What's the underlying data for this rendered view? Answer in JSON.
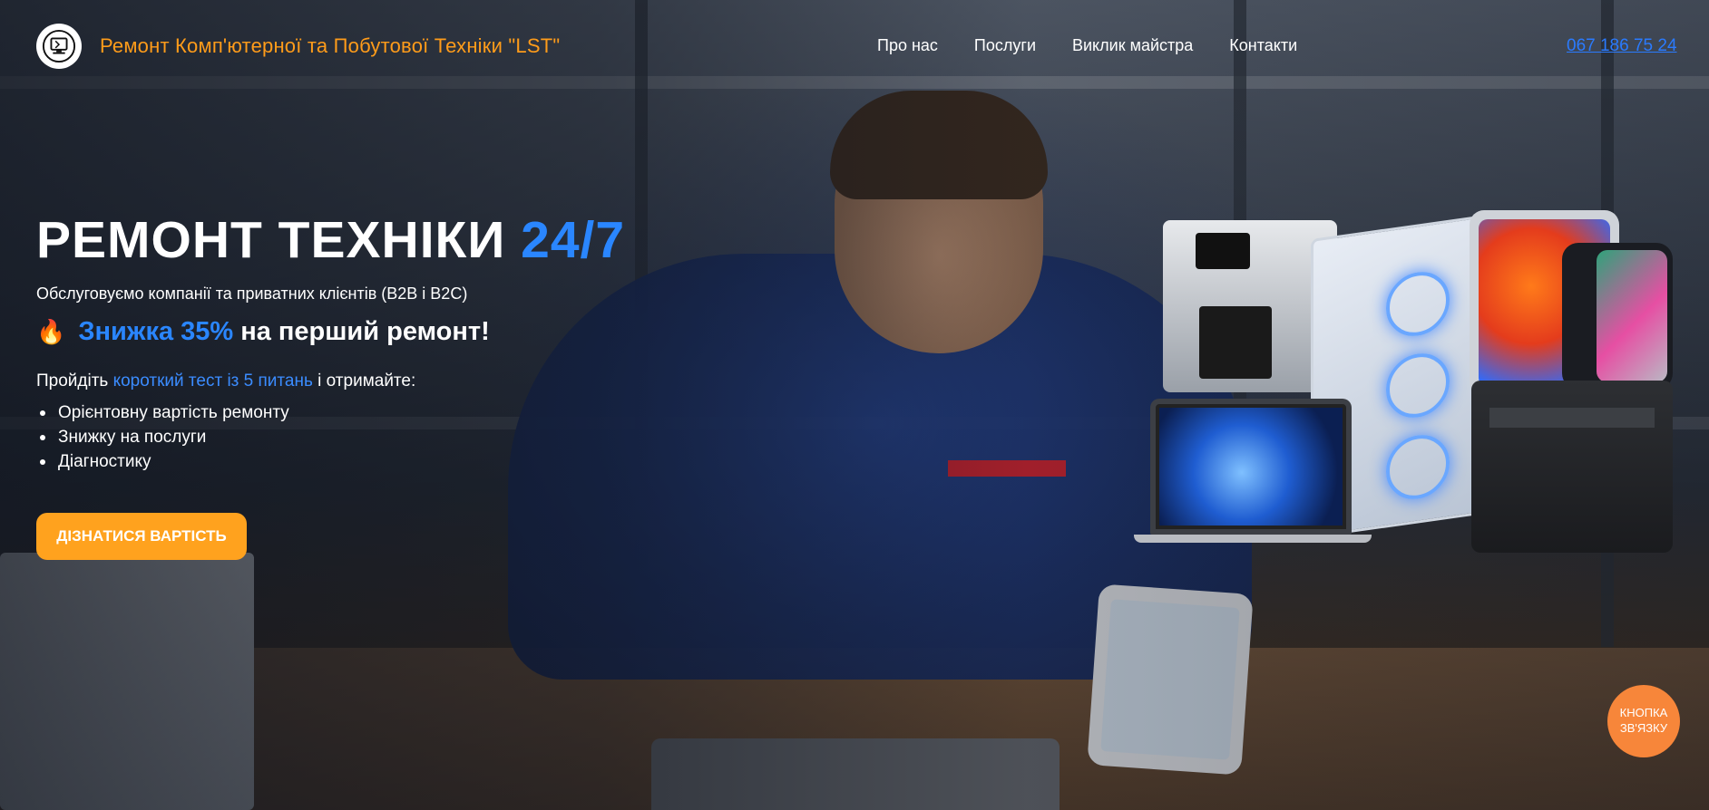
{
  "header": {
    "brand_name": "Ремонт Комп'ютерної та Побутової Техніки \"LST\"",
    "logo_icon": "computer-repair-logo-icon",
    "nav": [
      {
        "label": "Про нас"
      },
      {
        "label": "Послуги"
      },
      {
        "label": "Виклик майстра"
      },
      {
        "label": "Контакти"
      }
    ],
    "phone": "067 186 75 24"
  },
  "hero": {
    "title_main": "РЕМОНТ ТЕХНІКИ",
    "title_accent": "24/7",
    "subtitle": "Обслуговуємо компанії та приватних клієнтів (B2B і B2C)",
    "promo_icon": "fire-icon",
    "promo_highlight": "Знижка 35%",
    "promo_rest": "на перший ремонт!",
    "quiz_prefix": "Пройдіть",
    "quiz_link": "короткий тест із 5 питань",
    "quiz_suffix": "і отримайте:",
    "benefits": [
      "Орієнтовну вартість ремонту",
      "Знижку на послуги",
      "Діагностику"
    ],
    "cta_label": "ДІЗНАТИСЯ ВАРТІСТЬ"
  },
  "floating": {
    "contact_button": "КНОПКА ЗВ'ЯЗКУ"
  },
  "colors": {
    "brand_orange": "#ff9c1a",
    "accent_blue": "#2a86ff",
    "cta_orange": "#ffa21e",
    "contact_orange": "#f7863a"
  }
}
